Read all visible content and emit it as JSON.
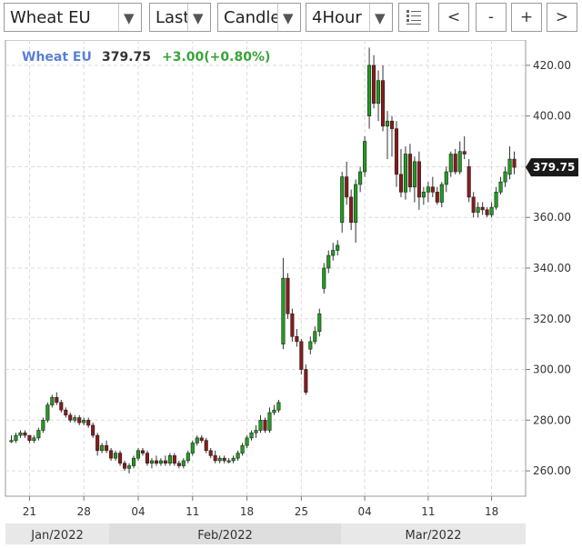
{
  "toolbar": {
    "symbol": "Wheat EU",
    "price_type": "Last",
    "chart_style": "Candle",
    "interval": "4Hour",
    "prev_label": "<",
    "zoom_out_label": "-",
    "zoom_in_label": "+",
    "next_label": ">"
  },
  "header": {
    "symbol": "Wheat EU",
    "last": "379.75",
    "change": "+3.00(+0.80%)"
  },
  "current_price_label": "379.75",
  "colors": {
    "up": "#1e9e1e",
    "down": "#8b1a1a",
    "symbol": "#5b7fd6",
    "change": "#39a339",
    "price_tag": "#1a1a1a"
  },
  "chart_data": {
    "type": "candlestick",
    "ylim": [
      250,
      430
    ],
    "y_ticks": [
      "260.00",
      "280.00",
      "300.00",
      "320.00",
      "340.00",
      "360.00",
      "380.00",
      "400.00",
      "420.00"
    ],
    "x_ticks": [
      "21",
      "28",
      "04",
      "11",
      "18",
      "25",
      "04",
      "11",
      "18"
    ],
    "months": [
      "Jan/2022",
      "Feb/2022",
      "Mar/2022"
    ],
    "grid": true,
    "candles": [
      [
        272,
        274,
        271,
        272
      ],
      [
        272,
        275,
        271,
        274
      ],
      [
        274,
        276,
        273,
        275
      ],
      [
        275,
        276,
        273,
        274
      ],
      [
        274,
        274,
        271,
        272
      ],
      [
        272,
        274,
        271,
        273
      ],
      [
        273,
        277,
        272,
        276
      ],
      [
        276,
        281,
        275,
        280
      ],
      [
        280,
        287,
        279,
        286
      ],
      [
        286,
        290,
        285,
        289
      ],
      [
        289,
        291,
        286,
        287
      ],
      [
        287,
        288,
        283,
        284
      ],
      [
        284,
        285,
        281,
        282
      ],
      [
        282,
        283,
        279,
        280
      ],
      [
        280,
        282,
        279,
        281
      ],
      [
        281,
        282,
        278,
        279
      ],
      [
        279,
        281,
        278,
        280
      ],
      [
        280,
        281,
        277,
        278
      ],
      [
        278,
        279,
        273,
        274
      ],
      [
        274,
        275,
        266,
        268
      ],
      [
        268,
        271,
        267,
        270
      ],
      [
        270,
        272,
        267,
        268
      ],
      [
        268,
        269,
        264,
        265
      ],
      [
        265,
        268,
        264,
        267
      ],
      [
        267,
        268,
        262,
        263
      ],
      [
        263,
        264,
        260,
        261
      ],
      [
        261,
        263,
        259,
        262
      ],
      [
        262,
        266,
        261,
        265
      ],
      [
        265,
        269,
        264,
        268
      ],
      [
        268,
        269,
        266,
        267
      ],
      [
        267,
        268,
        262,
        263
      ],
      [
        263,
        265,
        261,
        264
      ],
      [
        264,
        266,
        262,
        263
      ],
      [
        263,
        265,
        262,
        264
      ],
      [
        264,
        266,
        262,
        263
      ],
      [
        263,
        267,
        262,
        266
      ],
      [
        266,
        267,
        262,
        263
      ],
      [
        263,
        264,
        261,
        262
      ],
      [
        262,
        265,
        261,
        264
      ],
      [
        264,
        268,
        263,
        267
      ],
      [
        267,
        272,
        266,
        271
      ],
      [
        271,
        274,
        270,
        273
      ],
      [
        273,
        274,
        271,
        272
      ],
      [
        272,
        273,
        267,
        268
      ],
      [
        268,
        269,
        265,
        266
      ],
      [
        266,
        268,
        263,
        264
      ],
      [
        264,
        266,
        263,
        265
      ],
      [
        265,
        266,
        263,
        264
      ],
      [
        264,
        265,
        263,
        264
      ],
      [
        264,
        266,
        263,
        265
      ],
      [
        265,
        268,
        264,
        267
      ],
      [
        267,
        271,
        266,
        270
      ],
      [
        270,
        274,
        269,
        273
      ],
      [
        273,
        276,
        272,
        275
      ],
      [
        275,
        278,
        273,
        276
      ],
      [
        276,
        282,
        275,
        280
      ],
      [
        280,
        281,
        275,
        276
      ],
      [
        276,
        285,
        275,
        283
      ],
      [
        283,
        286,
        282,
        284
      ],
      [
        284,
        288,
        283,
        287
      ],
      [
        310,
        344,
        308,
        336
      ],
      [
        336,
        338,
        320,
        322
      ],
      [
        322,
        324,
        311,
        313
      ],
      [
        313,
        316,
        309,
        311
      ],
      [
        311,
        312,
        298,
        300
      ],
      [
        300,
        302,
        290,
        291
      ],
      [
        308,
        313,
        306,
        311
      ],
      [
        311,
        317,
        310,
        315
      ],
      [
        315,
        324,
        313,
        322
      ],
      [
        332,
        342,
        330,
        340
      ],
      [
        340,
        347,
        338,
        345
      ],
      [
        345,
        350,
        343,
        347
      ],
      [
        347,
        351,
        345,
        349
      ],
      [
        358,
        378,
        354,
        376
      ],
      [
        376,
        382,
        365,
        368
      ],
      [
        368,
        371,
        355,
        358
      ],
      [
        358,
        375,
        350,
        373
      ],
      [
        373,
        380,
        370,
        378
      ],
      [
        378,
        392,
        376,
        390
      ],
      [
        400,
        427,
        395,
        420
      ],
      [
        420,
        424,
        403,
        405
      ],
      [
        405,
        418,
        398,
        414
      ],
      [
        414,
        420,
        394,
        396
      ],
      [
        396,
        402,
        383,
        398
      ],
      [
        398,
        400,
        384,
        395
      ],
      [
        395,
        398,
        372,
        377
      ],
      [
        377,
        387,
        368,
        370
      ],
      [
        370,
        388,
        367,
        385
      ],
      [
        385,
        389,
        370,
        372
      ],
      [
        372,
        384,
        366,
        382
      ],
      [
        382,
        386,
        363,
        368
      ],
      [
        368,
        372,
        365,
        370
      ],
      [
        370,
        374,
        366,
        372
      ],
      [
        372,
        376,
        368,
        370
      ],
      [
        370,
        372,
        365,
        366
      ],
      [
        366,
        374,
        364,
        373
      ],
      [
        373,
        380,
        370,
        378
      ],
      [
        378,
        386,
        376,
        385
      ],
      [
        385,
        387,
        377,
        378
      ],
      [
        378,
        390,
        377,
        386
      ],
      [
        386,
        392,
        383,
        385
      ],
      [
        380,
        383,
        366,
        368
      ],
      [
        368,
        370,
        360,
        362
      ],
      [
        362,
        366,
        360,
        364
      ],
      [
        364,
        366,
        361,
        363
      ],
      [
        363,
        364,
        360,
        361
      ],
      [
        361,
        366,
        360,
        364
      ],
      [
        364,
        372,
        363,
        370
      ],
      [
        370,
        376,
        369,
        374
      ],
      [
        374,
        380,
        372,
        378
      ],
      [
        377,
        388,
        375,
        383
      ],
      [
        383,
        386,
        377,
        379.75
      ]
    ]
  }
}
